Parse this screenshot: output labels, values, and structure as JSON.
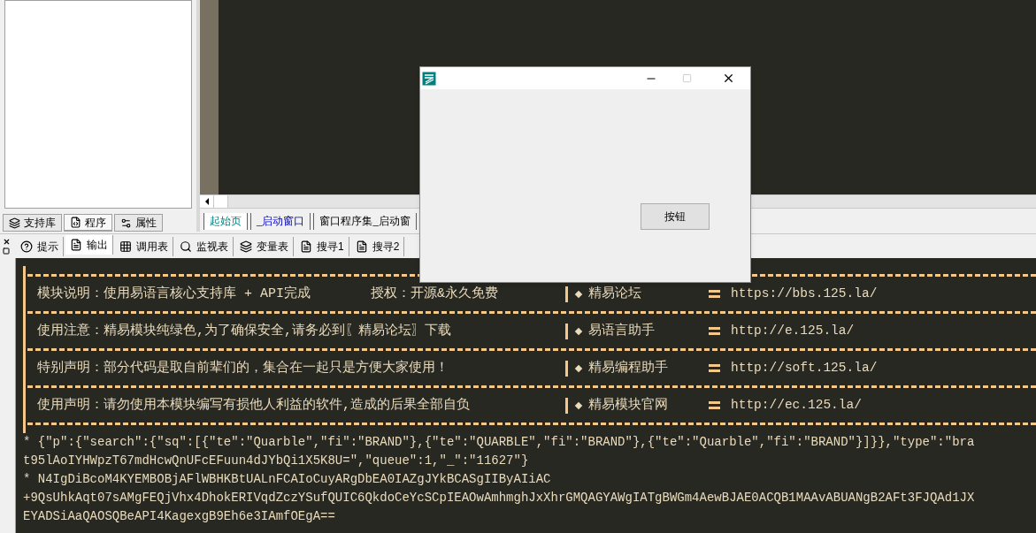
{
  "left_panel": {
    "tabs": [
      {
        "label": "支持库",
        "selected": false
      },
      {
        "label": "程序",
        "selected": true
      },
      {
        "label": "属性",
        "selected": false
      }
    ]
  },
  "editor": {
    "tabs": [
      {
        "label": "起始页",
        "selected": true,
        "kind": "page"
      },
      {
        "label": "_启动窗口",
        "selected": false,
        "kind": "window"
      },
      {
        "label": "窗口程序集_启动窗",
        "selected": false,
        "kind": "code"
      }
    ]
  },
  "output_panel": {
    "tabs": [
      {
        "label": "提示",
        "selected": false
      },
      {
        "label": "输出",
        "selected": true
      },
      {
        "label": "调用表",
        "selected": false
      },
      {
        "label": "监视表",
        "selected": false
      },
      {
        "label": "变量表",
        "selected": false
      },
      {
        "label": "搜寻1",
        "selected": false
      },
      {
        "label": "搜寻2",
        "selected": false
      }
    ],
    "banner": [
      {
        "texts": [
          "模块说明：使用易语言核心支持库 + API完成",
          "授权：开源&永久免费"
        ],
        "site": "精易论坛",
        "url": "https://bbs.125.la/"
      },
      {
        "texts": [
          "使用注意：精易模块纯绿色,为了确保安全,请务必到〖精易论坛〗下载"
        ],
        "site": "易语言助手",
        "url": "http://e.125.la/"
      },
      {
        "texts": [
          "特别声明：部分代码是取自前辈们的，集合在一起只是方便大家使用！"
        ],
        "site": "精易编程助手",
        "url": "http://soft.125.la/"
      },
      {
        "texts": [
          "使用声明：请勿使用本模块编写有损他人利益的软件,造成的后果全部自负"
        ],
        "site": "精易模块官网",
        "url": "http://ec.125.la/"
      }
    ],
    "log_lines": [
      "* {\"p\":{\"search\":{\"sq\":[{\"te\":\"Quarble\",\"fi\":\"BRAND\"},{\"te\":\"QUARBLE\",\"fi\":\"BRAND\"},{\"te\":\"Quarble\",\"fi\":\"BRAND\"}]}},\"type\":\"bra",
      "t95lAoIYHWpzT67mdHcwQnUFcEFuun4dJYbQi1X5K8U=\",\"queue\":1,\"_\":\"11627\"}",
      "* N4IgDiBcoM4KYEMBOBjAFlWBHKBtUALnFCAIoCuyARgDbEA0IAZgJYkBCASgIIByAIiAC",
      "+9QsUhkAqt07sAMgFEQjVhx4DhokERIVqdZczYSufQUIC6QkdoCeYcSCpIEAOwAmhmghJxXhrGMQAGYAWgIATgBWGm4AewBJAE0ACQB1MAAvABUANgB2AFt3FJQAd1JX",
      "EYADSiAaQAOSQBeAPI4KagexgB9Eh6e3IAmfOEgA=="
    ]
  },
  "dialog": {
    "button": "按钮"
  }
}
